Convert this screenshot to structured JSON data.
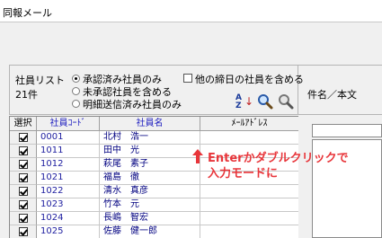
{
  "window": {
    "title": "同報メール"
  },
  "options": {
    "list_label": "社員リスト",
    "count": "21件",
    "radios": [
      {
        "label": "承認済み社員のみ",
        "selected": true
      },
      {
        "label": "未承認社員を含める",
        "selected": false
      },
      {
        "label": "明細送信済み社員のみ",
        "selected": false
      }
    ],
    "include_other_label": "他の締日の社員を含める",
    "include_other_checked": false
  },
  "right_panel": {
    "name_body_label": "件名／本文"
  },
  "table": {
    "headers": [
      "選択",
      "社員ｺｰﾄﾞ",
      "社員名",
      "ﾒｰﾙｱﾄﾞﾚｽ"
    ],
    "rows": [
      {
        "code": "0001",
        "name": "北村　浩一",
        "email": "",
        "checked": true
      },
      {
        "code": "1011",
        "name": "田中　光",
        "email": "",
        "checked": true
      },
      {
        "code": "1012",
        "name": "萩尾　素子",
        "email": "",
        "checked": true
      },
      {
        "code": "1021",
        "name": "福島　徹",
        "email": "",
        "checked": true
      },
      {
        "code": "1022",
        "name": "清水　真彦",
        "email": "",
        "checked": true
      },
      {
        "code": "1023",
        "name": "竹本　元",
        "email": "",
        "checked": true
      },
      {
        "code": "1024",
        "name": "長嶋　智宏",
        "email": "",
        "checked": true
      },
      {
        "code": "1025",
        "name": "佐藤　健一郎",
        "email": "",
        "checked": true
      }
    ]
  },
  "annotation": {
    "line1": "Enterかダブルクリックで",
    "line2": "入力モードに"
  },
  "colors": {
    "accent_red": "#e8353a",
    "link_blue": "#2020c0"
  },
  "icons": [
    "sort-az-icon",
    "search-icon",
    "clear-search-icon",
    "up-arrow-icon"
  ]
}
